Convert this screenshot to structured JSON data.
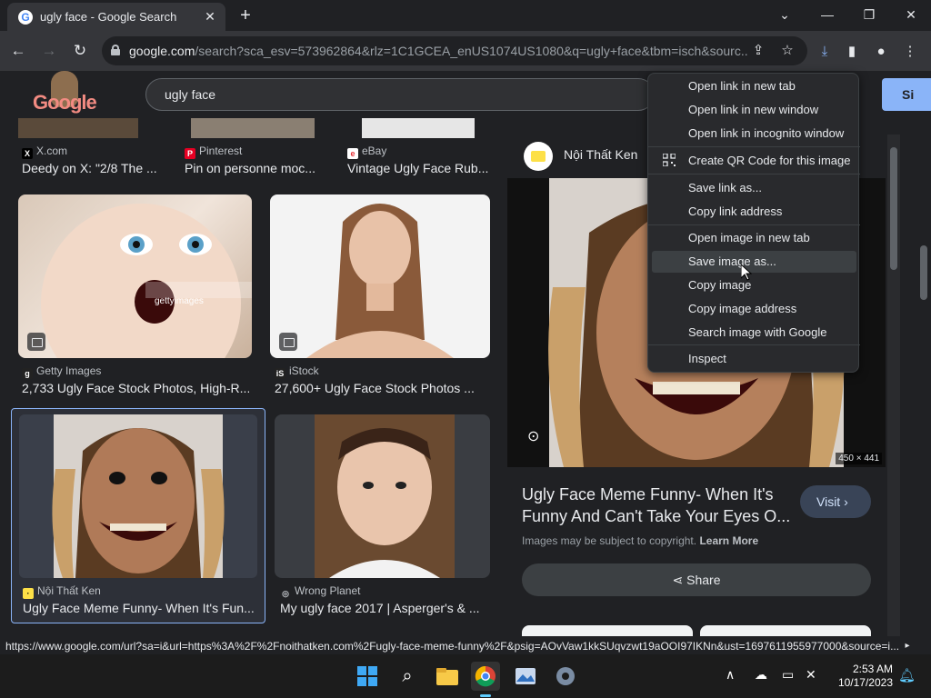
{
  "browser": {
    "tab_title": "ugly face - Google Search",
    "url_host": "google.com",
    "url_path": "/search?sca_esv=573962864&rlz=1C1GCEA_enUS1074US1080&q=ugly+face&tbm=isch&sourc..."
  },
  "google": {
    "logo_text": "Google",
    "query": "ugly face",
    "signin_label": "Si"
  },
  "results": [
    {
      "source": "X.com",
      "title": "Deedy on X: \"2/8 The ..."
    },
    {
      "source": "Pinterest",
      "title": "Pin on personne moc..."
    },
    {
      "source": "eBay",
      "title": "Vintage Ugly Face Rub..."
    },
    {
      "source": "Getty Images",
      "title": "2,733 Ugly Face Stock Photos, High-R..."
    },
    {
      "source": "iStock",
      "title": "27,600+ Ugly Face Stock Photos ..."
    },
    {
      "source": "Nội Thất Ken",
      "title": "Ugly Face Meme Funny- When It's Fun..."
    },
    {
      "source": "Wrong Planet",
      "title": "My ugly face 2017 | Asperger's & ..."
    }
  ],
  "watermark": "gettyimages",
  "panel": {
    "source": "Nội Thất Ken",
    "title": "Ugly Face Meme Funny- When It's Funny And Can't Take Your Eyes O...",
    "visit_label": "Visit",
    "dimensions": "450 × 441",
    "copyright": "Images may be subject to copyright.",
    "learn_more": "Learn More",
    "share_label": "Share"
  },
  "context_menu": [
    "Open link in new tab",
    "Open link in new window",
    "Open link in incognito window",
    "Create QR Code for this image",
    "Save link as...",
    "Copy link address",
    "Open image in new tab",
    "Save image as...",
    "Copy image",
    "Copy image address",
    "Search image with Google",
    "Inspect"
  ],
  "status_url": "https://www.google.com/url?sa=i&url=https%3A%2F%2Fnoithatken.com%2Fugly-face-meme-funny%2F&psig=AOvVaw1kkSUqvzwt19aOOI97IKNn&ust=1697611955977000&source=i...",
  "taskbar": {
    "time": "2:53 AM",
    "date": "10/17/2023"
  },
  "colors": {
    "accent": "#8ab4f8",
    "menu_bg": "#292a2d",
    "page_bg": "#202124"
  }
}
